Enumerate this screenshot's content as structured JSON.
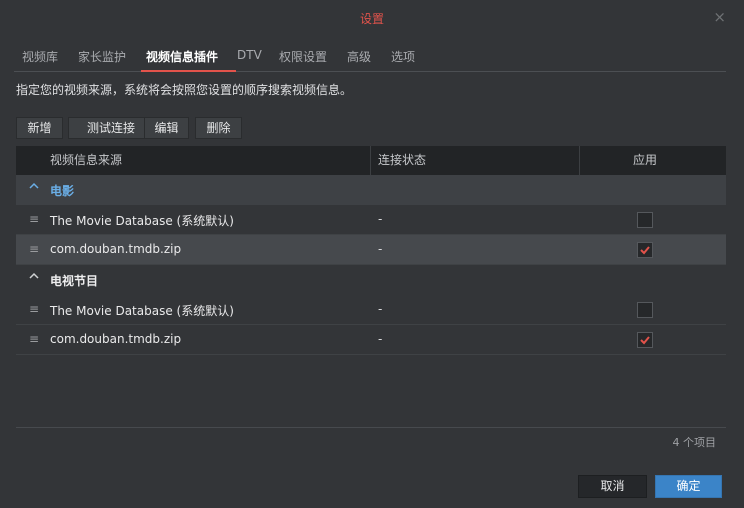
{
  "dialog": {
    "title": "设置",
    "close_icon": "×"
  },
  "tabs": [
    {
      "label": "视频库"
    },
    {
      "label": "家长监护"
    },
    {
      "label": "视频信息插件",
      "active": true
    },
    {
      "label": "DTV"
    },
    {
      "label": "权限设置"
    },
    {
      "label": "高级"
    },
    {
      "label": "选项"
    }
  ],
  "description": "指定您的视频来源，系统将会按照您设置的顺序搜索视频信息。",
  "toolbar": {
    "add": "新增",
    "test": "测试连接",
    "edit": "编辑",
    "delete": "删除"
  },
  "table": {
    "columns": [
      "视频信息来源",
      "连接状态",
      "应用"
    ],
    "groups": [
      {
        "label": "电影",
        "highlight_color": "#6aaee6",
        "rows": [
          {
            "name": "The Movie Database (系统默认)",
            "status": "-",
            "checked": false
          },
          {
            "name": "com.douban.tmdb.zip",
            "status": "-",
            "checked": true
          }
        ]
      },
      {
        "label": "电视节目",
        "rows": [
          {
            "name": "The Movie Database (系统默认)",
            "status": "-",
            "checked": false
          },
          {
            "name": "com.douban.tmdb.zip",
            "status": "-",
            "checked": true
          }
        ]
      }
    ]
  },
  "count": "4 个项目",
  "buttons": {
    "cancel": "取消",
    "ok": "确定"
  },
  "colors": {
    "accent": "#e2534b",
    "primary": "#3b84c8",
    "check": "#e2534b"
  }
}
